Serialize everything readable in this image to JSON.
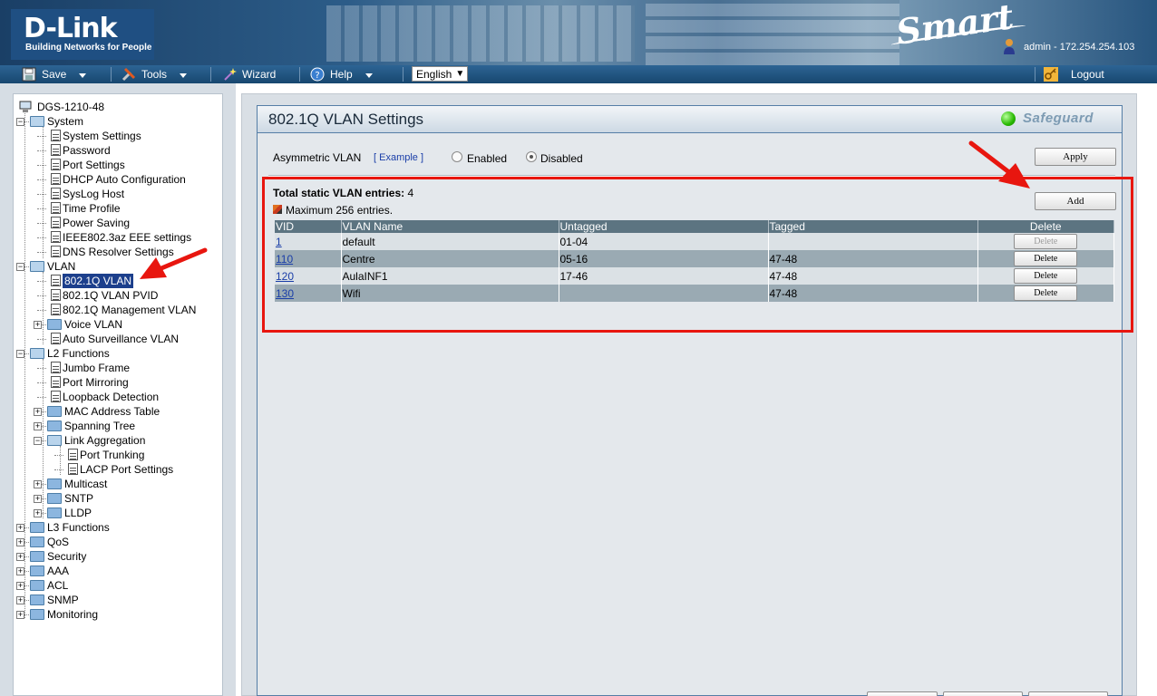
{
  "header": {
    "logo_main": "D-Link",
    "logo_tagline": "Building Networks for People",
    "product_logo": "Smart",
    "user_info": "admin - 172.254.254.103"
  },
  "menubar": {
    "save": "Save",
    "tools": "Tools",
    "wizard": "Wizard",
    "help": "Help",
    "language": "English",
    "logout": "Logout"
  },
  "tree": {
    "device": "DGS-1210-48",
    "system": "System",
    "system_settings": "System Settings",
    "password": "Password",
    "port_settings": "Port Settings",
    "dhcp_auto": "DHCP Auto Configuration",
    "syslog_host": "SysLog Host",
    "time_profile": "Time Profile",
    "power_saving": "Power Saving",
    "eee_settings": "IEEE802.3az EEE settings",
    "dns_resolver": "DNS Resolver Settings",
    "vlan": "VLAN",
    "vlan_8021q": "802.1Q VLAN",
    "vlan_pvid": "802.1Q VLAN PVID",
    "vlan_mgmt": "802.1Q Management VLAN",
    "voice_vlan": "Voice VLAN",
    "surveillance_vlan": "Auto Surveillance VLAN",
    "l2_functions": "L2 Functions",
    "jumbo_frame": "Jumbo Frame",
    "port_mirroring": "Port Mirroring",
    "loopback": "Loopback Detection",
    "mac_table": "MAC Address Table",
    "spanning_tree": "Spanning Tree",
    "link_aggregation": "Link Aggregation",
    "port_trunking": "Port Trunking",
    "lacp": "LACP Port Settings",
    "multicast": "Multicast",
    "sntp": "SNTP",
    "lldp": "LLDP",
    "l3_functions": "L3 Functions",
    "qos": "QoS",
    "security": "Security",
    "aaa": "AAA",
    "acl": "ACL",
    "snmp": "SNMP",
    "monitoring": "Monitoring"
  },
  "panel": {
    "title": "802.1Q VLAN Settings",
    "safeguard": "Safeguard",
    "asym_label": "Asymmetric VLAN",
    "asym_example": "[ Example ]",
    "enabled": "Enabled",
    "disabled": "Disabled",
    "asym_selected": "Disabled",
    "apply": "Apply",
    "add": "Add",
    "total_label": "Total static VLAN entries:",
    "total_value": "4",
    "max_note": "Maximum 256 entries."
  },
  "table": {
    "headers": [
      "VID",
      "VLAN Name",
      "Untagged",
      "Tagged",
      "Delete"
    ],
    "delete_label": "Delete",
    "rows": [
      {
        "vid": "1",
        "name": "default",
        "untagged": "01-04",
        "tagged": "",
        "delete_enabled": false
      },
      {
        "vid": "110",
        "name": "Centre",
        "untagged": "05-16",
        "tagged": "47-48",
        "delete_enabled": true
      },
      {
        "vid": "120",
        "name": "AulaINF1",
        "untagged": "17-46",
        "tagged": "47-48",
        "delete_enabled": true
      },
      {
        "vid": "130",
        "name": "Wifi",
        "untagged": "",
        "tagged": "47-48",
        "delete_enabled": true
      }
    ]
  },
  "colors": {
    "accent": "#1f4f82",
    "selection": "#1c3f8c",
    "annotation": "#e8160f"
  }
}
